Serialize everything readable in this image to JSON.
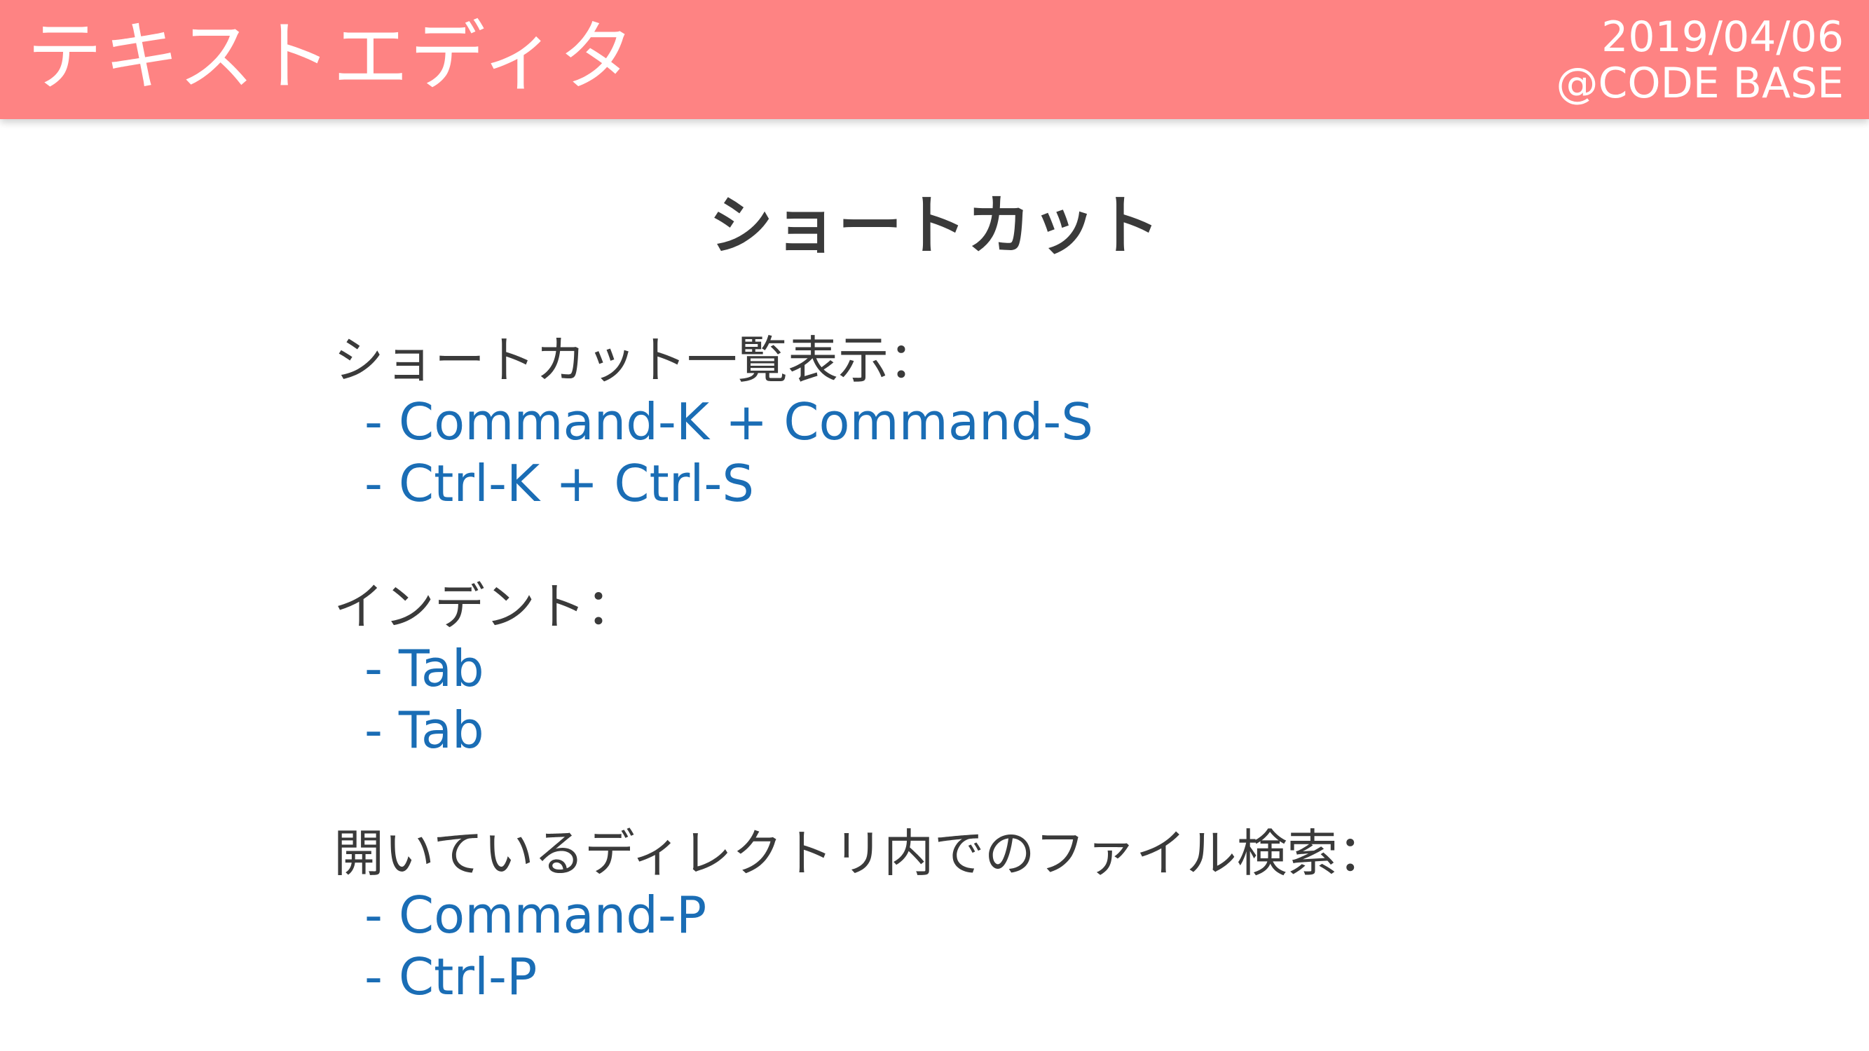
{
  "header": {
    "title": "テキストエディタ",
    "date": "2019/04/06",
    "org": "@CODE BASE",
    "background_color": "#fe8383"
  },
  "slide": {
    "title": "ショートカット",
    "sections": [
      {
        "label": "ショートカット一覧表示：",
        "items": [
          "- Command-K + Command-S",
          "- Ctrl-K + Ctrl-S"
        ]
      },
      {
        "label": "インデント：",
        "items": [
          "- Tab",
          "- Tab"
        ]
      },
      {
        "label": "開いているディレクトリ内でのファイル検索：",
        "items": [
          "- Command-P",
          "- Ctrl-P"
        ]
      }
    ],
    "text_color": "#3a3a3a",
    "accent_color": "#1a6db5"
  }
}
